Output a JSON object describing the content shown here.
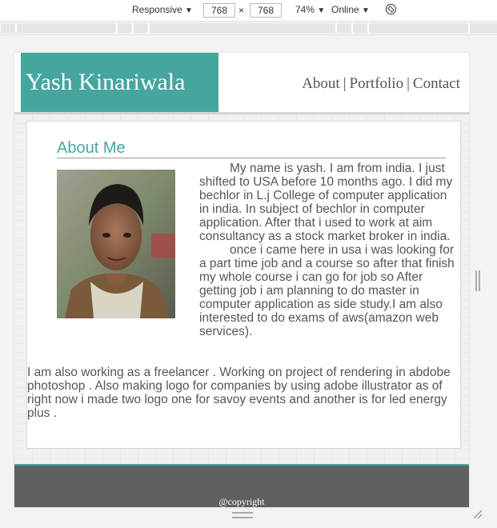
{
  "devtools": {
    "device": "Responsive",
    "width": "768",
    "height": "768",
    "times": "×",
    "zoom": "74%",
    "network": "Online",
    "dropdown_glyph": "▼",
    "icons": [
      "chevron-down-icon",
      "rotate-icon"
    ]
  },
  "header": {
    "brand": "Yash Kinariwala",
    "nav": [
      {
        "label": "About"
      },
      {
        "label": "Portfolio"
      },
      {
        "label": "Contact"
      }
    ],
    "nav_separator": "|"
  },
  "about": {
    "title": "About Me",
    "paragraph1": "My name is yash. I am from india. I just shifted to USA before 10 months ago. I did my bechlor in L.j College of computer application in india. In subject of bechlor in computer application. After that i used to work at aim consultancy as a stock market broker in india.",
    "paragraph2": "once i came here in usa i was looking for a part time job and a course so after that finish my whole course i can go for job so After getting job i am planning to do master in computer application as side study.I am also interested to do exams of aws(amazon web services).",
    "paragraph3": "I am also working as a freelancer . Working on project of rendering in abdobe photoshop . Also making logo for companies by using adobe illustrator as of right now i made two logo one for savoy events and another is for led energy plus ."
  },
  "footer": {
    "text": "@copyright"
  },
  "colors": {
    "accent": "#46a69f",
    "footer_bg": "#606060",
    "text": "#555555"
  }
}
